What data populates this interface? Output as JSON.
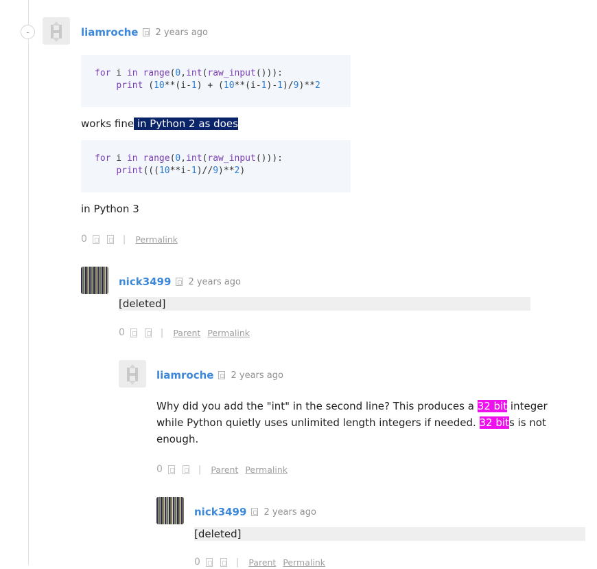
{
  "comments": [
    {
      "username": "liamroche",
      "timestamp": "2 years ago",
      "code1": "for i in range(0,int(raw_input())):\n    print (10**(i-1) + (10**(i-1)-1)/9)**2",
      "text1_a": "works fine",
      "text1_b": " in Python 2 as does ",
      "code2": "for i in range(0,int(raw_input())):\n    print(((10**i-1)//9)**2)",
      "text2": "in Python 3",
      "votes": "0",
      "permalink": "Permalink"
    },
    {
      "username": "nick3499",
      "timestamp": "2 years ago",
      "deleted": "[deleted]",
      "votes": "0",
      "parent": "Parent",
      "permalink": "Permalink"
    },
    {
      "username": "liamroche",
      "timestamp": "2 years ago",
      "text_a": "Why did you add the \"int\" in the second line? This produces a ",
      "hl1": "32 bit",
      "text_b": " integer",
      "text_c": "while Python quietly uses unlimited length integers if needed. ",
      "hl2": "32 bit",
      "text_d": "s is not",
      "text_e": "enough.",
      "votes": "0",
      "parent": "Parent",
      "permalink": "Permalink"
    },
    {
      "username": "nick3499",
      "timestamp": "2 years ago",
      "deleted": "[deleted]",
      "votes": "0",
      "parent": "Parent",
      "permalink": "Permalink"
    }
  ],
  "icons": {
    "collapse": "collapse-icon",
    "flag": "flag-icon",
    "upvote": "upvote-icon",
    "downvote": "downvote-icon"
  },
  "colors": {
    "username": "#3d88d9",
    "selection": "#0a246a",
    "highlight": "#ee11ee",
    "code_bg": "#f3f6fa"
  },
  "collapse_symbol": "-"
}
